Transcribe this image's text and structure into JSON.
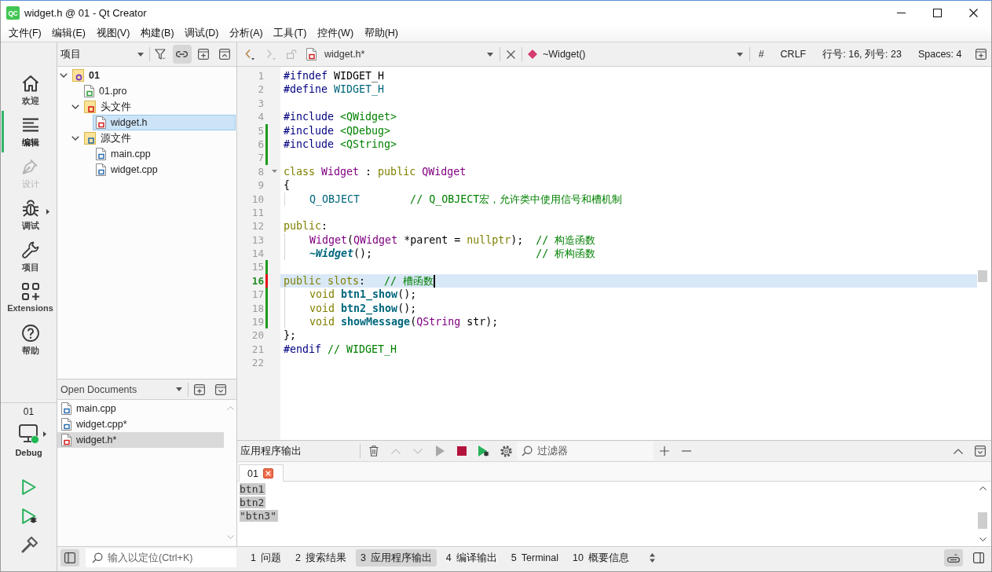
{
  "window": {
    "logo": "QC",
    "title": "widget.h @ 01 - Qt Creator"
  },
  "menu": [
    "文件(F)",
    "编辑(E)",
    "视图(V)",
    "构建(B)",
    "调试(D)",
    "分析(A)",
    "工具(T)",
    "控件(W)",
    "帮助(H)"
  ],
  "modes": [
    {
      "label": "欢迎",
      "kind": "welcome",
      "selected": false,
      "disabled": false,
      "submenu": false
    },
    {
      "label": "编辑",
      "kind": "edit",
      "selected": true,
      "disabled": false,
      "submenu": false
    },
    {
      "label": "设计",
      "kind": "design",
      "selected": false,
      "disabled": true,
      "submenu": false
    },
    {
      "label": "调试",
      "kind": "debug",
      "selected": false,
      "disabled": false,
      "submenu": true
    },
    {
      "label": "项目",
      "kind": "projects",
      "selected": false,
      "disabled": false,
      "submenu": false
    },
    {
      "label": "Extensions",
      "kind": "extensions",
      "selected": false,
      "disabled": false,
      "submenu": false
    },
    {
      "label": "帮助",
      "kind": "help",
      "selected": false,
      "disabled": false,
      "submenu": false
    }
  ],
  "kit": {
    "project": "01",
    "build": "Debug"
  },
  "project_pane": {
    "view": "项目",
    "sync_with_editor": true,
    "tree": [
      {
        "label": "01",
        "kind": "project",
        "expanded": true,
        "selected": false,
        "children": [
          {
            "label": "01.pro",
            "kind": "pro",
            "selected": false
          },
          {
            "label": "头文件",
            "kind": "headers",
            "expanded": true,
            "selected": false,
            "children": [
              {
                "label": "widget.h",
                "kind": "header",
                "selected": true
              }
            ]
          },
          {
            "label": "源文件",
            "kind": "sources",
            "expanded": true,
            "selected": false,
            "children": [
              {
                "label": "main.cpp",
                "kind": "source",
                "selected": false
              },
              {
                "label": "widget.cpp",
                "kind": "source",
                "selected": false
              }
            ]
          }
        ]
      }
    ]
  },
  "open_documents": {
    "title": "Open Documents",
    "items": [
      {
        "label": "main.cpp",
        "kind": "source",
        "selected": false
      },
      {
        "label": "widget.cpp*",
        "kind": "source",
        "selected": false
      },
      {
        "label": "widget.h*",
        "kind": "header",
        "selected": true
      }
    ]
  },
  "editor": {
    "nav": [
      {
        "kind": "back",
        "disabled": false
      },
      {
        "kind": "forward",
        "disabled": true
      }
    ],
    "file": "widget.h*",
    "symbol": "~Widget()",
    "indicators": [
      "#",
      "CRLF",
      "行号: 16, 列号: 23",
      "Spaces: 4"
    ],
    "lines": [
      {
        "number": "1",
        "current": false,
        "modified": false,
        "tokens": [
          {
            "text": "#ifndef",
            "kind": "preprocessor"
          },
          {
            "text": " WIDGET_H",
            "kind": "plain"
          }
        ]
      },
      {
        "number": "2",
        "current": false,
        "modified": false,
        "tokens": [
          {
            "text": "#define",
            "kind": "preprocessor"
          },
          {
            "text": " WIDGET_H",
            "kind": "macro"
          }
        ]
      },
      {
        "number": "3",
        "current": false,
        "modified": false
      },
      {
        "number": "4",
        "current": false,
        "modified": false,
        "tokens": [
          {
            "text": "#include",
            "kind": "preprocessor"
          },
          {
            "text": " <QWidget>",
            "kind": "string"
          }
        ]
      },
      {
        "number": "5",
        "current": false,
        "modified": true,
        "saved": true,
        "tokens": [
          {
            "text": "#include",
            "kind": "preprocessor"
          },
          {
            "text": " <QDebug>",
            "kind": "string"
          }
        ]
      },
      {
        "number": "6",
        "current": false,
        "modified": true,
        "saved": true,
        "tokens": [
          {
            "text": "#include",
            "kind": "preprocessor"
          },
          {
            "text": " <QString>",
            "kind": "string"
          }
        ]
      },
      {
        "number": "7",
        "current": false,
        "modified": true,
        "saved": true
      },
      {
        "number": "8",
        "current": false,
        "modified": false,
        "expanded": true,
        "tokens": [
          {
            "text": "class",
            "kind": "keyword"
          },
          {
            "text": " Widget",
            "kind": "type"
          },
          {
            "text": " : ",
            "kind": "plain"
          },
          {
            "text": "public",
            "kind": "keyword"
          },
          {
            "text": " QWidget",
            "kind": "type"
          }
        ]
      },
      {
        "number": "9",
        "current": false,
        "modified": false,
        "tokens": [
          {
            "text": "{",
            "kind": "plain"
          }
        ]
      },
      {
        "number": "10",
        "current": false,
        "modified": false,
        "tokens": [
          {
            "text": "    Q_OBJECT",
            "kind": "macro"
          },
          {
            "text": "        // Q_OBJECT宏，允许类中使用信号和槽机制",
            "kind": "comment"
          }
        ]
      },
      {
        "number": "11",
        "current": false,
        "modified": false
      },
      {
        "number": "12",
        "current": false,
        "modified": false,
        "tokens": [
          {
            "text": "public",
            "kind": "keyword"
          },
          {
            "text": ":",
            "kind": "plain"
          }
        ]
      },
      {
        "number": "13",
        "current": false,
        "modified": false,
        "tokens": [
          {
            "text": "    Widget",
            "kind": "type"
          },
          {
            "text": "(",
            "kind": "plain"
          },
          {
            "text": "QWidget",
            "kind": "type"
          },
          {
            "text": " *parent = ",
            "kind": "plain"
          },
          {
            "text": "nullptr",
            "kind": "keyword"
          },
          {
            "text": ");",
            "kind": "plain"
          },
          {
            "text": "  // 构造函数",
            "kind": "comment"
          }
        ]
      },
      {
        "number": "14",
        "current": false,
        "modified": false,
        "tokens": [
          {
            "text": "    ~Widget",
            "kind": "virtual"
          },
          {
            "text": "();",
            "kind": "plain"
          },
          {
            "text": "                          // 析构函数",
            "kind": "comment"
          }
        ]
      },
      {
        "number": "15",
        "current": false,
        "modified": true,
        "saved": true
      },
      {
        "number": "16",
        "current": true,
        "modified": true,
        "saved": false,
        "tokens": [
          {
            "text": "public slots",
            "kind": "keyword"
          },
          {
            "text": ":",
            "kind": "plain"
          },
          {
            "text": "   // 槽函数",
            "kind": "comment"
          }
        ]
      },
      {
        "number": "17",
        "current": false,
        "modified": true,
        "saved": true,
        "tokens": [
          {
            "text": "    void",
            "kind": "keyword"
          },
          {
            "text": " btn1_show",
            "kind": "function"
          },
          {
            "text": "();",
            "kind": "plain"
          }
        ]
      },
      {
        "number": "18",
        "current": false,
        "modified": true,
        "saved": true,
        "tokens": [
          {
            "text": "    void",
            "kind": "keyword"
          },
          {
            "text": " btn2_show",
            "kind": "function"
          },
          {
            "text": "();",
            "kind": "plain"
          }
        ]
      },
      {
        "number": "19",
        "current": false,
        "modified": true,
        "saved": true,
        "tokens": [
          {
            "text": "    void",
            "kind": "keyword"
          },
          {
            "text": " showMessage",
            "kind": "function"
          },
          {
            "text": "(",
            "kind": "plain"
          },
          {
            "text": "QString",
            "kind": "type"
          },
          {
            "text": " str);",
            "kind": "plain"
          }
        ]
      },
      {
        "number": "20",
        "current": false,
        "modified": false,
        "tokens": [
          {
            "text": "};",
            "kind": "plain"
          }
        ]
      },
      {
        "number": "21",
        "current": false,
        "modified": false,
        "tokens": [
          {
            "text": "#endif",
            "kind": "preprocessor"
          },
          {
            "text": " // WIDGET_H",
            "kind": "comment"
          }
        ]
      },
      {
        "number": "22",
        "current": false,
        "modified": false
      }
    ]
  },
  "output_pane": {
    "title": "应用程序输出",
    "controls": [
      {
        "kind": "clear",
        "disabled": false
      },
      {
        "kind": "prev",
        "disabled": true
      },
      {
        "kind": "next",
        "disabled": true
      },
      {
        "kind": "rerun",
        "disabled": true
      },
      {
        "kind": "stop",
        "disabled": false
      },
      {
        "kind": "debug",
        "disabled": false
      },
      {
        "kind": "settings",
        "disabled": false
      }
    ],
    "filter_placeholder": "过滤器",
    "tabs": [
      {
        "label": "01",
        "selected": true
      }
    ],
    "lines": [
      {
        "text": "btn1",
        "selected": true
      },
      {
        "text": "btn2",
        "selected": true
      },
      {
        "text": "\"btn3\"",
        "selected": true
      }
    ]
  },
  "status_bar": {
    "left_sidebar_on": true,
    "locator_placeholder": "输入以定位(Ctrl+K)",
    "panes": [
      {
        "number": "1",
        "label": "问题",
        "selected": false
      },
      {
        "number": "2",
        "label": "搜索结果",
        "selected": false
      },
      {
        "number": "3",
        "label": "应用程序输出",
        "selected": true
      },
      {
        "number": "4",
        "label": "编译输出",
        "selected": false
      },
      {
        "number": "5",
        "label": "Terminal",
        "selected": false
      },
      {
        "number": "10",
        "label": "概要信息",
        "selected": false
      }
    ],
    "progress_details_on": true,
    "right_sidebar_on": false
  }
}
